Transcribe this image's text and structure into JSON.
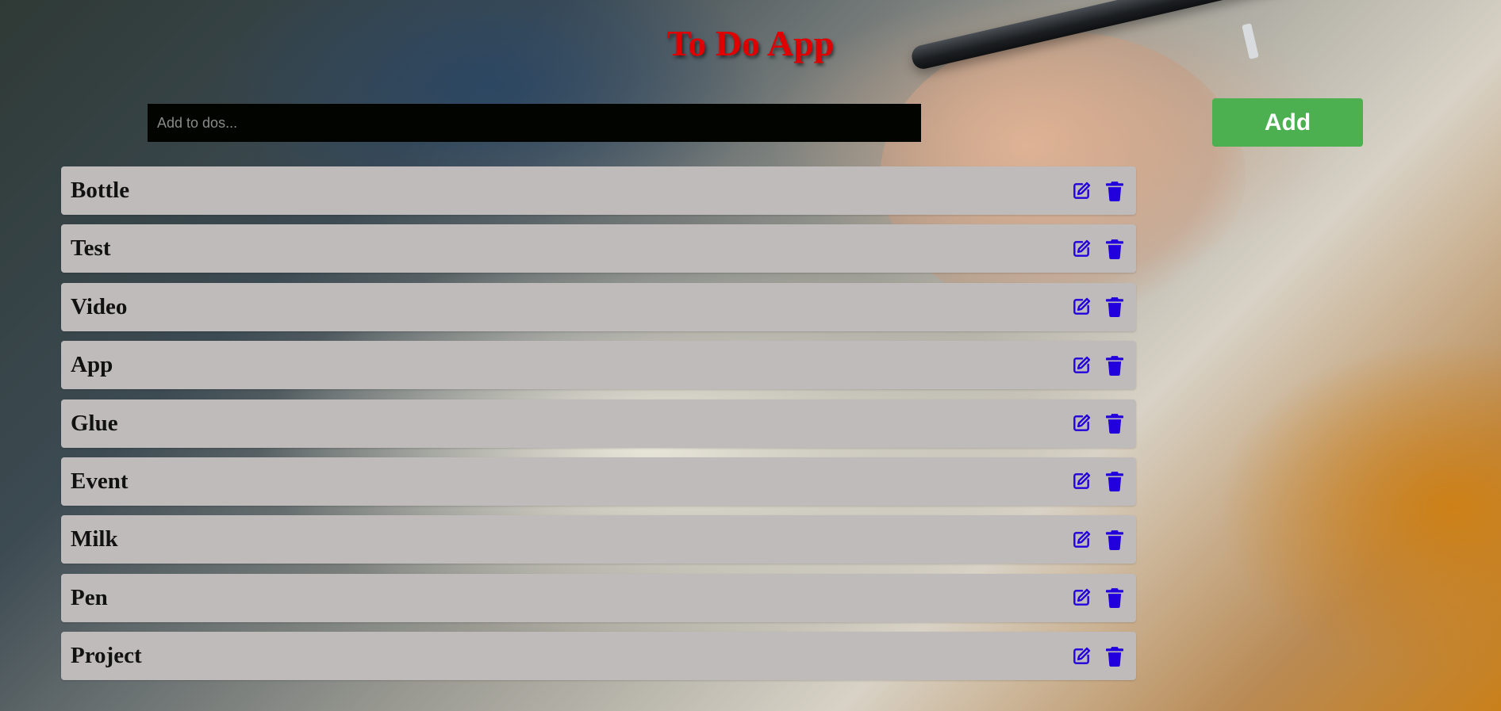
{
  "app": {
    "title": "To Do App"
  },
  "input": {
    "placeholder": "Add to dos...",
    "value": ""
  },
  "add_button": {
    "label": "Add"
  },
  "todos": [
    {
      "text": "Bottle"
    },
    {
      "text": "Test"
    },
    {
      "text": "Video"
    },
    {
      "text": "App"
    },
    {
      "text": "Glue"
    },
    {
      "text": "Event"
    },
    {
      "text": "Milk"
    },
    {
      "text": "Pen"
    },
    {
      "text": "Project"
    }
  ],
  "icons": {
    "edit": "edit-icon",
    "delete": "trash-icon"
  },
  "colors": {
    "title": "#e00000",
    "add_button_bg": "#4caf50",
    "input_bg": "#020400",
    "item_bg": "#bfbbbb",
    "icon": "#2200dd"
  }
}
